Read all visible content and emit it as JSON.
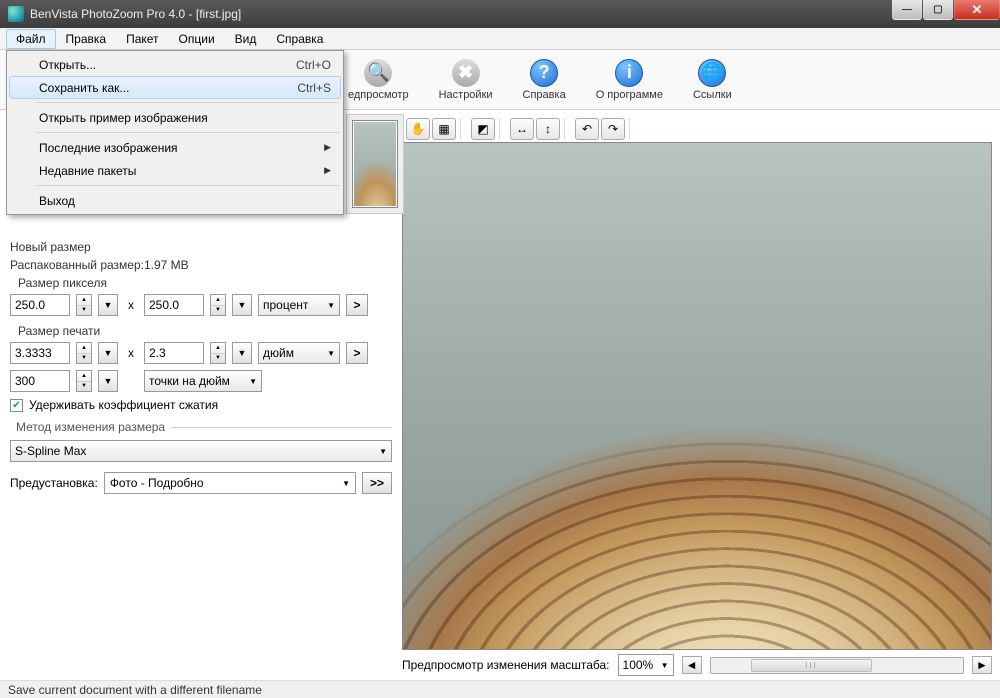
{
  "titlebar": {
    "text": "BenVista PhotoZoom Pro 4.0 - [first.jpg]"
  },
  "menubar": {
    "items": [
      "Файл",
      "Правка",
      "Пакет",
      "Опции",
      "Вид",
      "Справка"
    ]
  },
  "file_menu": {
    "open": {
      "label": "Открыть...",
      "shortcut": "Ctrl+O"
    },
    "save_as": {
      "label": "Сохранить как...",
      "shortcut": "Ctrl+S"
    },
    "open_sample": {
      "label": "Открыть пример изображения"
    },
    "recent_images": {
      "label": "Последние изображения"
    },
    "recent_batches": {
      "label": "Недавние пакеты"
    },
    "exit": {
      "label": "Выход"
    }
  },
  "toolbar": {
    "preview": "едпросмотр",
    "settings": "Настройки",
    "help": "Справка",
    "about": "О программе",
    "links": "Ссылки"
  },
  "left": {
    "new_size_label": "Новый размер",
    "unpacked_label": "Распакованный размер:1.97 MB",
    "pixel_size_label": "Размер пикселя",
    "pixel_w": "250.0",
    "pixel_h": "250.0",
    "pixel_unit": "процент",
    "print_size_label": "Размер печати",
    "print_w": "3.3333",
    "print_h": "2.3",
    "print_unit": "дюйм",
    "dpi": "300",
    "dpi_unit": "точки на дюйм",
    "keep_ratio": "Удерживать коэффициент сжатия",
    "resize_method_label": "Метод изменения размера",
    "resize_method": "S-Spline Max",
    "preset_label": "Предустановка:",
    "preset_value": "Фото - Подробно",
    "preset_btn": ">>",
    "arrow_btn": ">",
    "x": "x"
  },
  "zoom": {
    "label": "Предпросмотр изменения масштаба:",
    "value": "100%"
  },
  "statusbar": {
    "text": "Save current document with a different filename"
  }
}
